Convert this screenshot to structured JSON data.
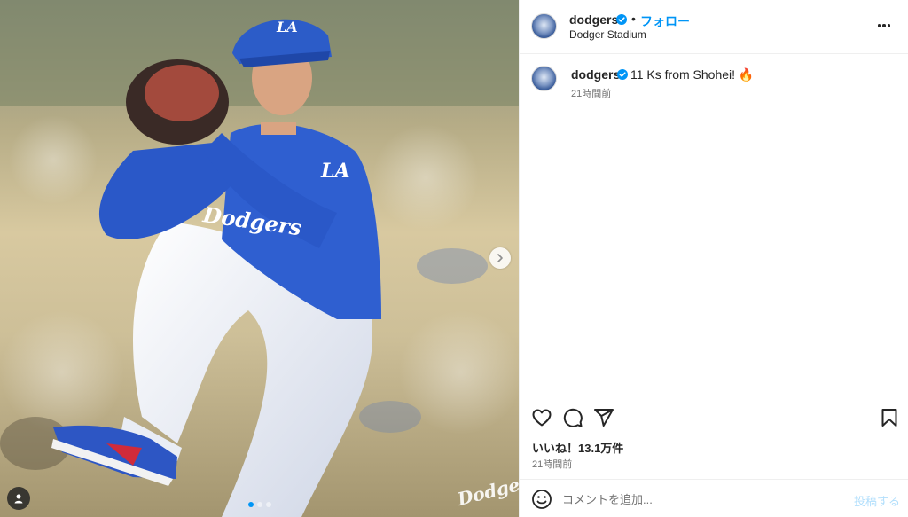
{
  "post": {
    "username": "dodgers",
    "verified": true,
    "follow_label": "フォロー",
    "separator": "•",
    "location": "Dodger Stadium",
    "more_icon": "more-horizontal-icon"
  },
  "caption": {
    "username": "dodgers",
    "text": "11 Ks from Shohei! 🔥",
    "time": "21時間前"
  },
  "media": {
    "carousel_count": 3,
    "active_index": 0,
    "watermark": "Dodgers",
    "cap_logo": "LA",
    "sleeve_logo": "LA",
    "jersey_text": "Dodgers"
  },
  "actions": {
    "icons": [
      "heart-icon",
      "comment-icon",
      "share-icon",
      "bookmark-icon"
    ],
    "likes_label": "いいね！13.1万件",
    "time": "21時間前"
  },
  "comment": {
    "placeholder": "コメントを追加...",
    "post_label": "投稿する"
  },
  "colors": {
    "accent": "#0095f6",
    "post_disabled": "#b2dffc",
    "secondary_text": "#737373"
  }
}
